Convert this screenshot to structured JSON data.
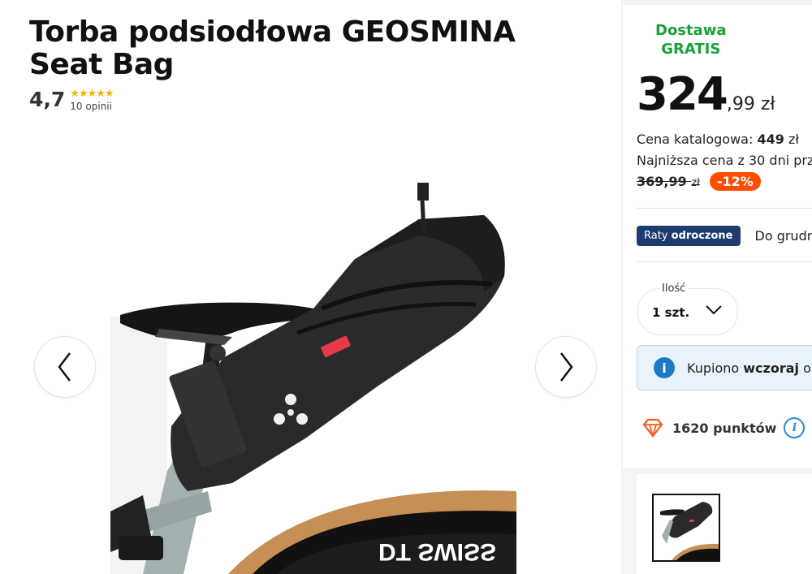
{
  "product": {
    "title": "Torba podsiodłowa GEOSMINA Seat Bag",
    "rating": "4,7",
    "stars": "★★★★★",
    "reviews": "10 opinii",
    "image_alt": "Torba podsiodłowa GEOSMINA Seat Bag na rowerze",
    "wheel_brand": "DT SWISS"
  },
  "gallery": {
    "prev_icon": "chevron-left-icon",
    "next_icon": "chevron-right-icon"
  },
  "delivery": {
    "line1": "Dostawa",
    "line2": "GRATIS",
    "color": "#1aa138"
  },
  "price": {
    "integer": "324",
    "decimal": ",99 zł",
    "catalog_label": "Cena katalogowa: ",
    "catalog_value": "449",
    "catalog_unit": " zł",
    "lowest_label": "Najniższa cena z 30 dni prz",
    "old_price": "369,99",
    "old_currency": "zł",
    "discount": "-12%",
    "discount_color": "#ff4d00"
  },
  "installments": {
    "badge_prefix": "Raty ",
    "badge_bold": "odroczone",
    "text": "Do grudn"
  },
  "quantity": {
    "label": "Ilość",
    "value": "1 szt."
  },
  "info": {
    "prefix": "Kupiono ",
    "bold": "wczoraj",
    "suffix": " o"
  },
  "points": {
    "text": "1620 punktów",
    "info_glyph": "i"
  }
}
